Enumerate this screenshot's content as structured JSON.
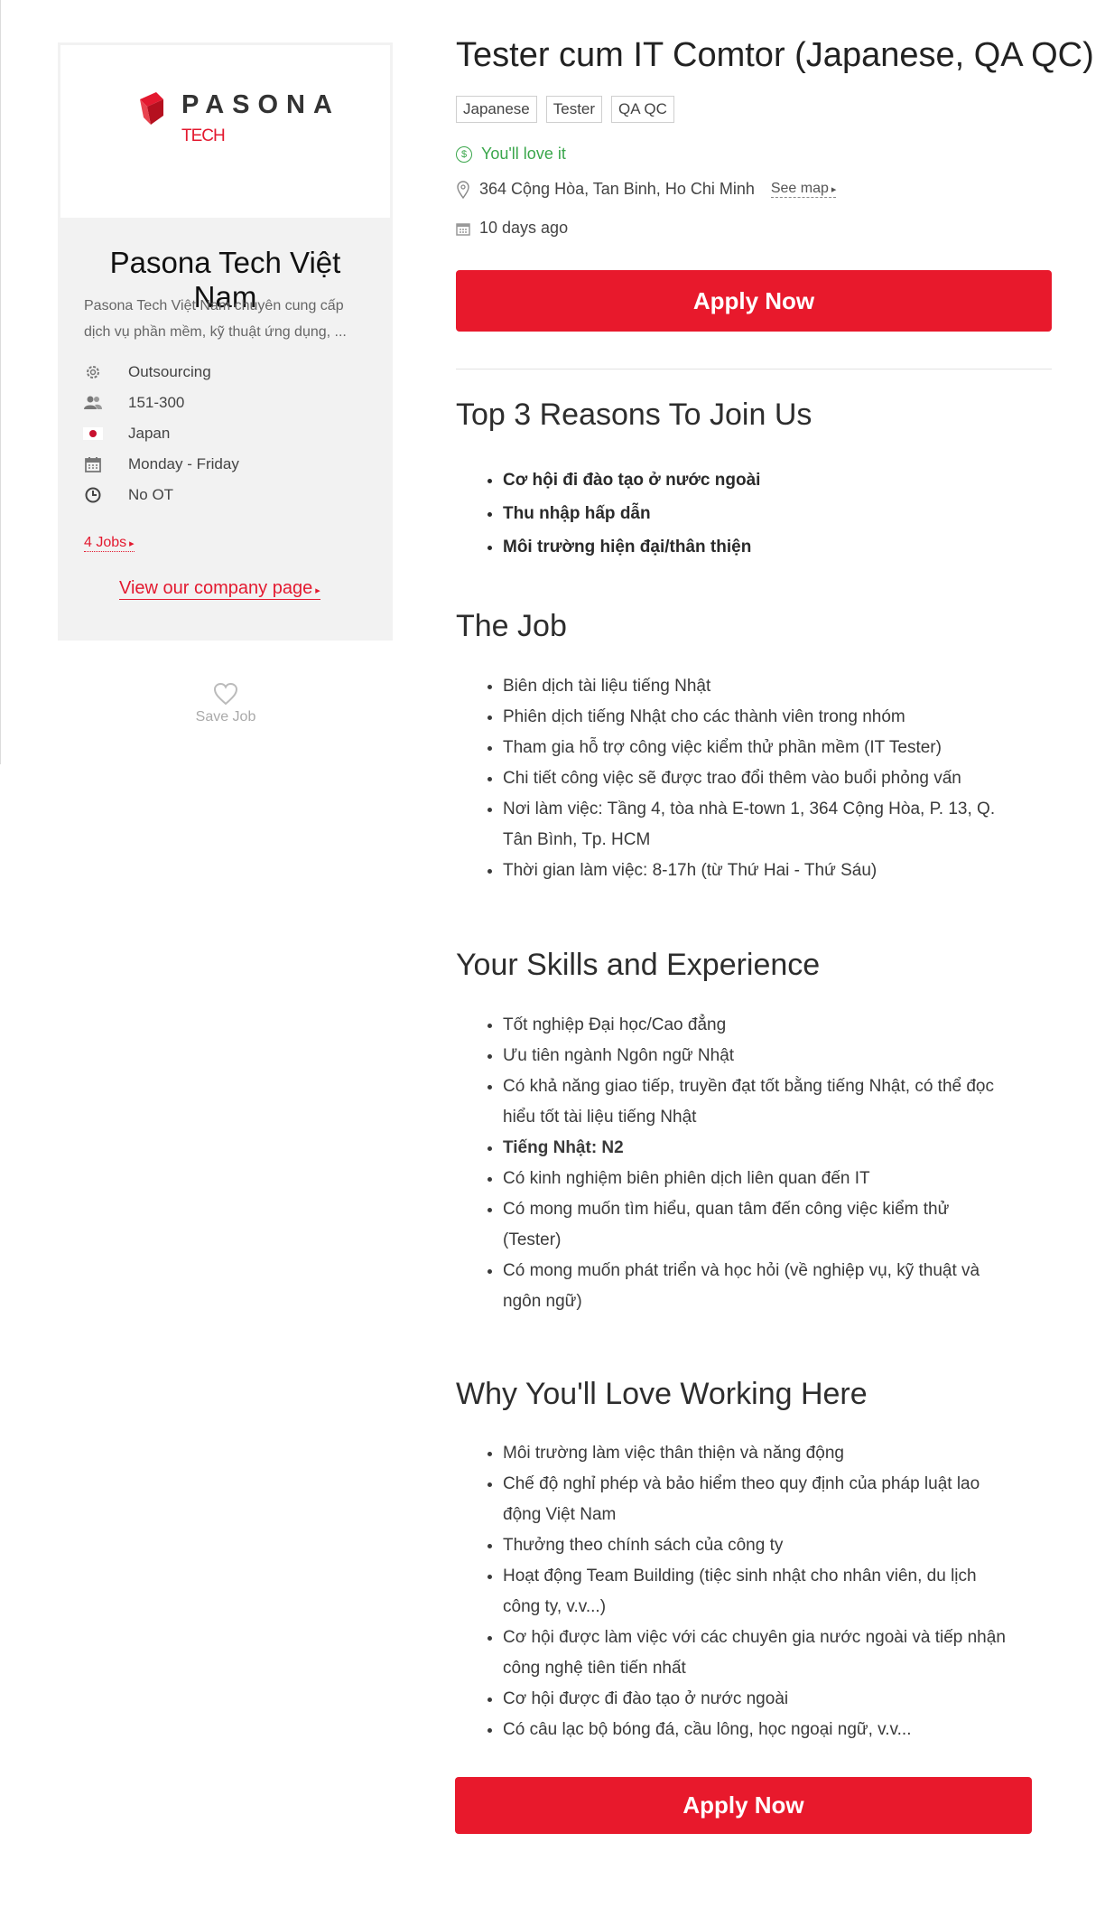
{
  "company": {
    "logo_word": "PASONA",
    "logo_sub": "TECH",
    "name": "Pasona Tech Việt Nam",
    "description": "Pasona Tech Việt Nam chuyên cung cấp dịch vụ phần mềm, kỹ thuật ứng dụng, ...",
    "info": [
      {
        "icon": "gear-icon",
        "text": "Outsourcing"
      },
      {
        "icon": "users-icon",
        "text": "151-300"
      },
      {
        "icon": "japan-flag-icon",
        "text": "Japan"
      },
      {
        "icon": "calendar-icon",
        "text": "Monday - Friday"
      },
      {
        "icon": "clock-icon",
        "text": "No OT"
      }
    ],
    "jobs_link": "4 Jobs",
    "company_page_link": "View our company page",
    "save_job": "Save Job"
  },
  "job": {
    "title": "Tester cum IT Comtor (Japanese, QA QC)",
    "tags": [
      "Japanese",
      "Tester",
      "QA QC"
    ],
    "salary": "You'll love it",
    "address": "364 Cộng Hòa, Tan Binh, Ho Chi Minh",
    "see_map": "See map",
    "posted": "10 days ago",
    "apply_label": "Apply Now"
  },
  "sections": {
    "reasons": {
      "title": "Top 3 Reasons To Join Us",
      "items": [
        "Cơ hội đi đào tạo ở nước ngoài",
        "Thu nhập hấp dẫn",
        "Môi trường hiện đại/thân thiện"
      ]
    },
    "job": {
      "title": "The Job",
      "items": [
        "Biên dịch tài liệu tiếng Nhật",
        "Phiên dịch tiếng Nhật cho các thành viên trong nhóm",
        "Tham gia hỗ trợ công việc kiểm thử phần mềm (IT Tester)",
        "Chi tiết công việc sẽ được trao đổi thêm vào buổi phỏng vấn",
        "Nơi làm việc: Tầng 4, tòa nhà E-town 1, 364 Cộng Hòa, P. 13, Q. Tân Bình, Tp. HCM",
        "Thời gian làm việc: 8-17h (từ Thứ Hai - Thứ Sáu)"
      ]
    },
    "skills": {
      "title": "Your Skills and Experience",
      "items": [
        "Tốt nghiệp Đại học/Cao đẳng",
        "Ưu tiên ngành Ngôn ngữ Nhật",
        "Có khả năng giao tiếp, truyền đạt tốt bằng tiếng Nhật, có thể đọc hiểu tốt tài liệu tiếng Nhật",
        "Tiếng Nhật: N2",
        "Có kinh nghiệm biên phiên dịch liên quan đến IT",
        "Có mong muốn tìm hiểu, quan tâm đến công việc kiểm thử (Tester)",
        "Có mong muốn phát triển và học hỏi (về nghiệp vụ, kỹ thuật và ngôn ngữ)"
      ]
    },
    "love": {
      "title": "Why You'll Love Working Here",
      "items": [
        "Môi trường làm việc thân thiện và năng động",
        "Chế độ nghỉ phép và bảo hiểm theo quy định của pháp luật lao động Việt Nam",
        "Thưởng theo chính sách của công ty",
        "Hoạt động Team Building (tiệc sinh nhật cho nhân viên, du lịch công ty, v.v...)",
        "Cơ hội được làm việc với các chuyên gia nước ngoài và tiếp nhận công nghệ tiên tiến nhất",
        "Cơ hội được đi đào tạo ở nước ngoài",
        "Có câu lạc bộ bóng đá, cầu lông, học ngoại ngữ, v.v..."
      ]
    }
  },
  "colors": {
    "accent": "#e8192c",
    "salary": "#3aa64b",
    "card_bg": "#f2f2f2"
  }
}
